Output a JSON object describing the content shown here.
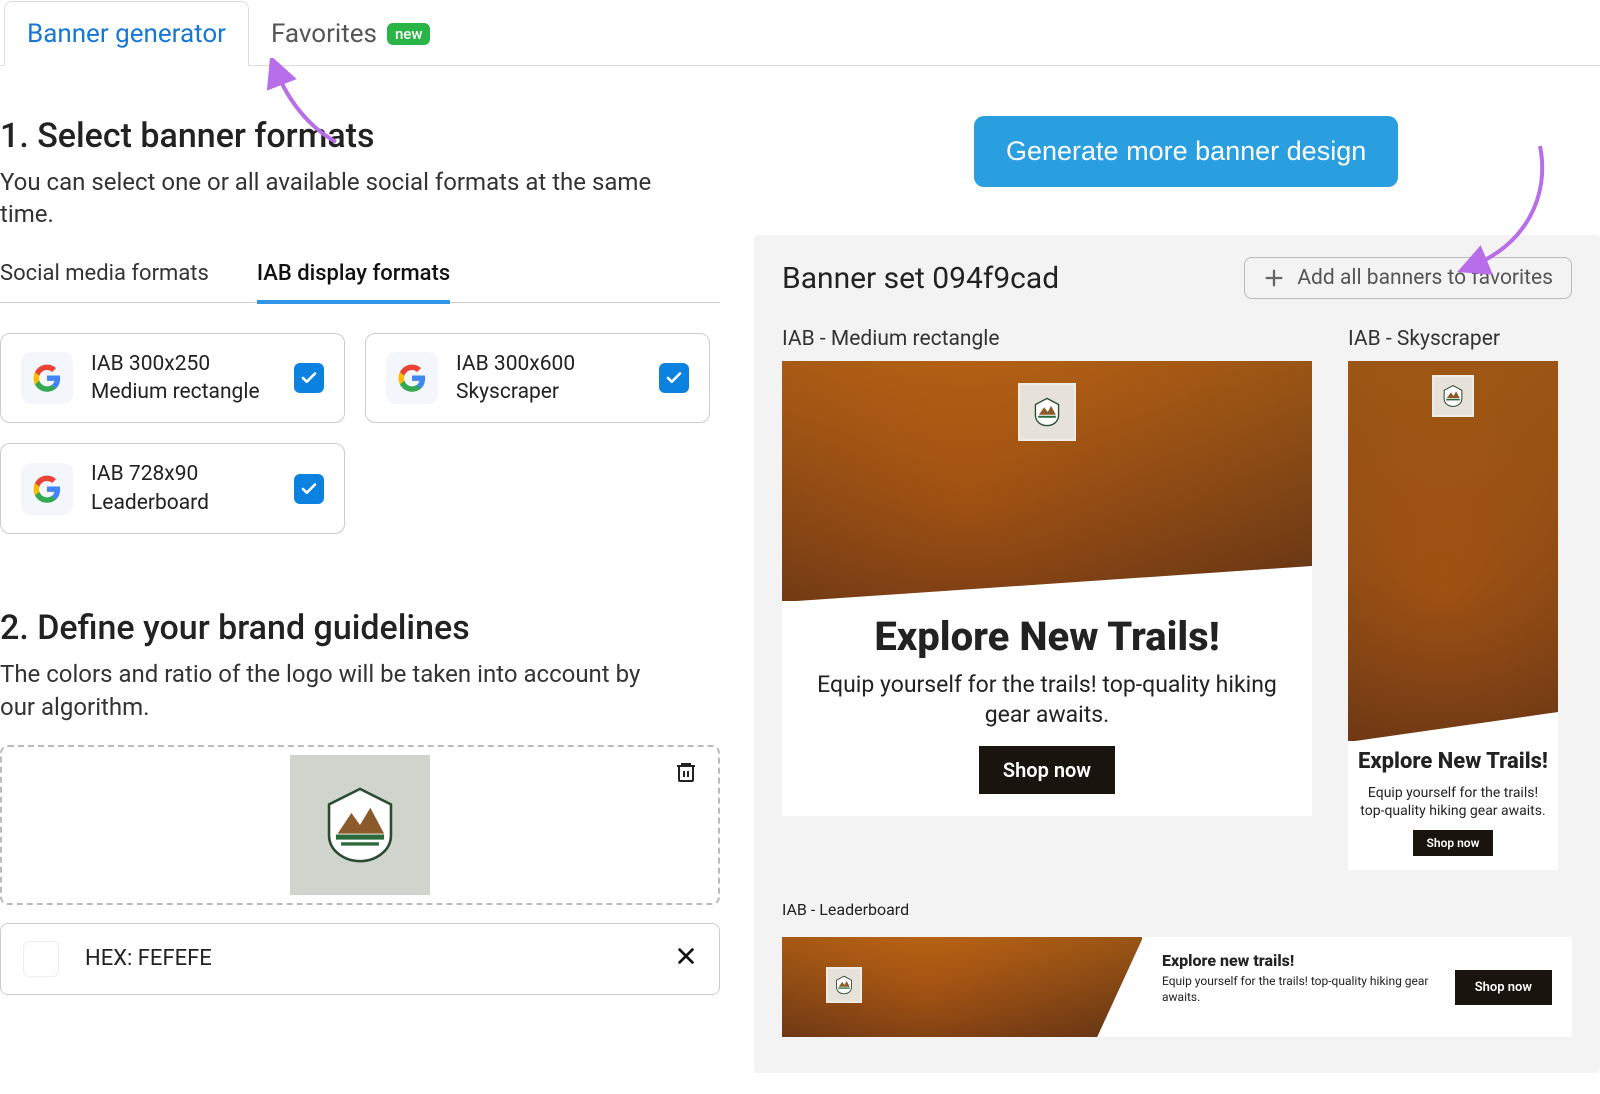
{
  "tabs": {
    "generator": "Banner generator",
    "favorites": "Favorites",
    "new_badge": "new"
  },
  "step1": {
    "heading": "1. Select banner formats",
    "sub": "You can select one or all available social formats at the same time."
  },
  "subtabs": {
    "social": "Social media formats",
    "iab": "IAB display formats"
  },
  "formats": [
    {
      "line1": "IAB 300x250",
      "line2": "Medium rectangle"
    },
    {
      "line1": "IAB 300x600",
      "line2": "Skyscraper"
    },
    {
      "line1": "IAB 728x90",
      "line2": "Leaderboard"
    }
  ],
  "step2": {
    "heading": "2. Define your brand guidelines",
    "sub": "The colors and ratio of the logo will be taken into account by our algorithm."
  },
  "hex": {
    "label": "HEX: FEFEFE"
  },
  "generate_btn": "Generate more banner design",
  "results": {
    "title": "Banner set 094f9cad",
    "add_fav": "Add all banners to favorites",
    "labels": {
      "med": "IAB - Medium rectangle",
      "sky": "IAB - Skyscraper",
      "lead": "IAB - Leaderboard"
    }
  },
  "ad": {
    "headline": "Explore New Trails!",
    "body": "Equip yourself for the trails! top-quality hiking gear awaits.",
    "cta": "Shop now",
    "lead_headline": "Explore new trails!"
  }
}
